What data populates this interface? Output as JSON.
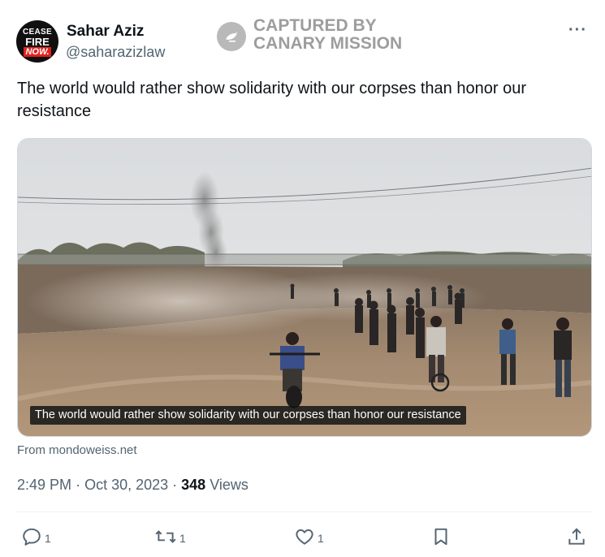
{
  "author": {
    "name": "Sahar Aziz",
    "handle": "@saharazizlaw",
    "avatar_text": [
      "CEASE",
      "FIRE",
      "NOW."
    ]
  },
  "watermark": {
    "line1": "CAPTURED BY",
    "line2": "CANARY MISSION"
  },
  "more_icon": "···",
  "tweet": {
    "text": "The world would rather show solidarity with our corpses than honor our resistance",
    "media_caption": "The world would rather show solidarity with our corpses than honor our resistance",
    "source": "From mondoweiss.net",
    "time": "2:49 PM",
    "date": "Oct 30, 2023",
    "views_count": "348",
    "views_label": "Views"
  },
  "actions": {
    "reply_count": "1",
    "retweet_count": "1",
    "like_count": "1"
  },
  "icons": [
    "more-icon",
    "canary-icon",
    "reply-icon",
    "retweet-icon",
    "like-icon",
    "bookmark-icon",
    "share-icon"
  ],
  "colors": {
    "text": "#0f1419",
    "secondary": "#536471",
    "watermark": "#9d9d9d",
    "divider": "#eff3f4",
    "avatar_red": "#e0211b"
  }
}
